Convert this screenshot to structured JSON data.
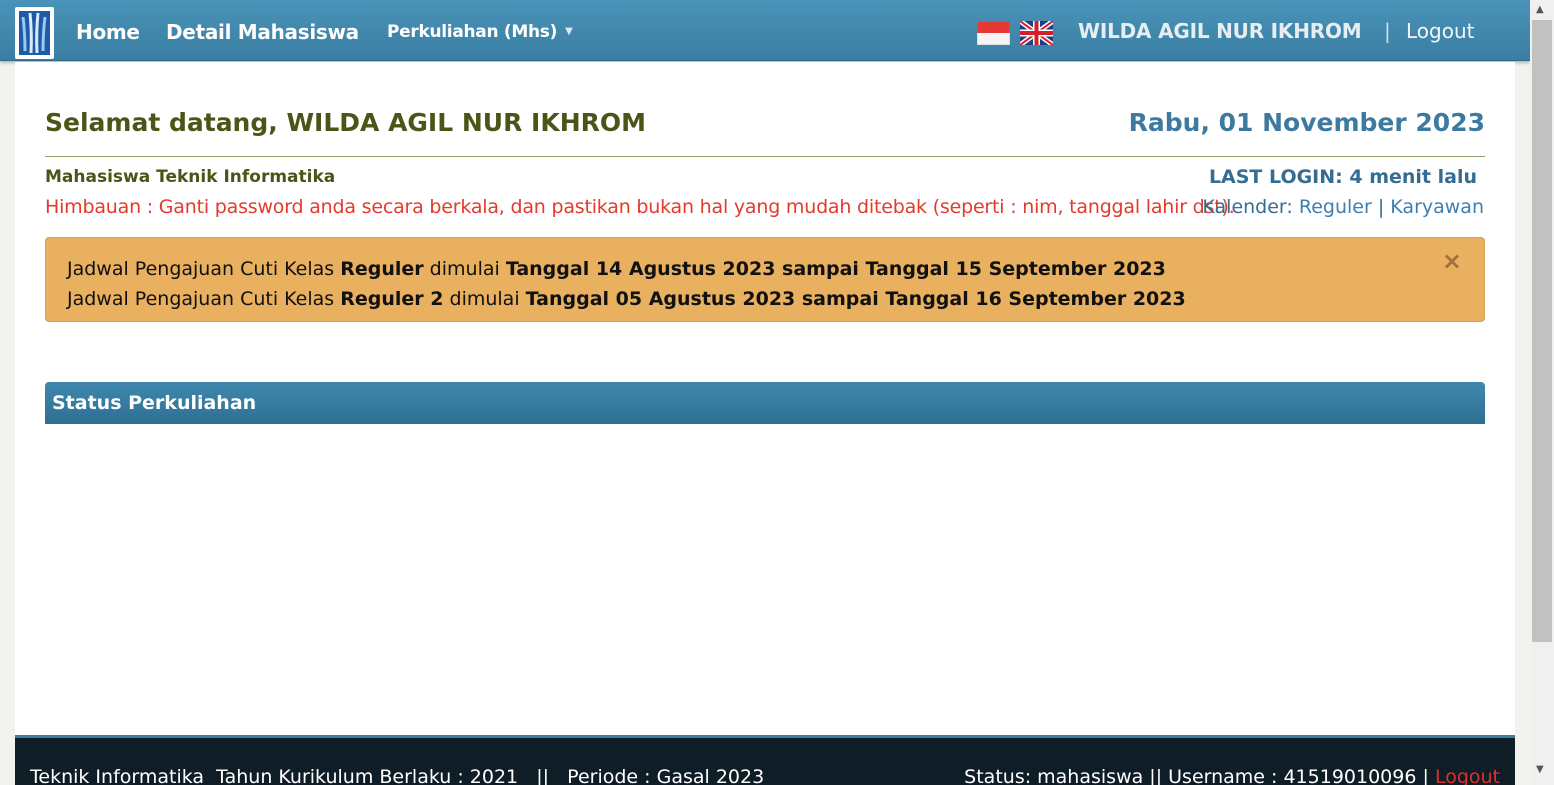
{
  "nav": {
    "home": "Home",
    "detail": "Detail Mahasiswa",
    "dropdown": "Perkuliahan (Mhs)",
    "user": "WILDA AGIL NUR IKHROM",
    "separator": "|",
    "logout": "Logout"
  },
  "main": {
    "welcome": "Selamat datang, WILDA AGIL NUR IKHROM",
    "date": "Rabu, 01 November 2023",
    "program": "Mahasiswa Teknik Informatika",
    "warning": "Himbauan : Ganti password anda secara berkala, dan pastikan bukan hal yang mudah ditebak (seperti : nim, tanggal lahir dst).",
    "last_login": "LAST LOGIN: 4 menit lalu",
    "calendar_label": "Kalender:",
    "calendar_reguler": "Reguler",
    "calendar_sep": "|",
    "calendar_karyawan": "Karyawan"
  },
  "alert": {
    "line1_a": "Jadwal Pengajuan Cuti Kelas ",
    "line1_b": "Reguler",
    "line1_c": " dimulai ",
    "line1_d": "Tanggal 14 Agustus 2023 sampai Tanggal 15 September 2023",
    "line2_a": "Jadwal Pengajuan Cuti Kelas ",
    "line2_b": "Reguler 2",
    "line2_c": " dimulai ",
    "line2_d": "Tanggal 05 Agustus 2023 sampai Tanggal 16 September 2023",
    "close": "×"
  },
  "panel": {
    "title": "Status Perkuliahan"
  },
  "footer": {
    "left": "Teknik Informatika  Tahun Kurikulum Berlaku : 2021   ||   Periode : Gasal 2023",
    "right": "Status: mahasiswa || Username : 41519010096 | ",
    "logout": "Logout"
  },
  "colors": {
    "navbar": "#3a7ea3",
    "welcome_text": "#4a5617",
    "warning_text": "#e23b2c",
    "alert_bg": "#e8b05f",
    "footer_bg": "#0f1d27"
  },
  "icons": [
    "university-logo-icon",
    "flag-indonesia-icon",
    "flag-uk-icon",
    "close-icon",
    "caret-down-icon"
  ]
}
